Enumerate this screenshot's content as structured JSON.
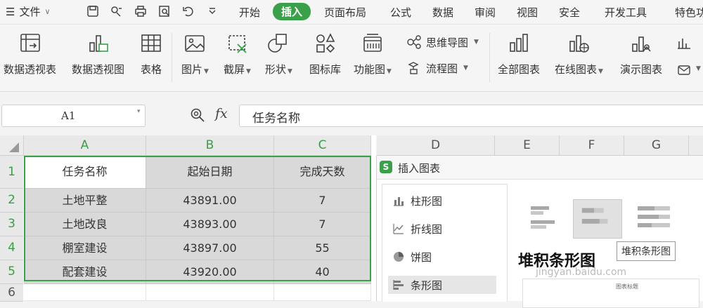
{
  "menubar": {
    "file_label": "文件",
    "tabs": [
      "开始",
      "插入",
      "页面布局",
      "公式",
      "数据",
      "审阅",
      "视图",
      "安全",
      "开发工具",
      "特色功"
    ],
    "active_tab": "插入"
  },
  "ribbon": {
    "pivot_table": "数据透视表",
    "pivot_chart": "数据透视图",
    "table": "表格",
    "picture": "图片",
    "screenshot": "截屏",
    "shapes": "形状",
    "icon_library": "图标库",
    "function_chart": "功能图",
    "mind_map": "思维导图",
    "flowchart": "流程图",
    "all_charts": "全部图表",
    "online_charts": "在线图表",
    "demo_chart": "演示图表"
  },
  "formula_bar": {
    "cell_ref": "A1",
    "fx_label": "fx",
    "value": "任务名称"
  },
  "sheet": {
    "columns": [
      "A",
      "B",
      "C"
    ],
    "right_columns": [
      "D",
      "E",
      "F",
      "G"
    ],
    "row_numbers": [
      "1",
      "2",
      "3",
      "4",
      "5",
      "6"
    ],
    "headers": [
      "任务名称",
      "起始日期",
      "完成天数"
    ],
    "rows": [
      [
        "土地平整",
        "43891.00",
        "7"
      ],
      [
        "土地改良",
        "43893.00",
        "7"
      ],
      [
        "棚室建设",
        "43897.00",
        "55"
      ],
      [
        "配套建设",
        "43920.00",
        "40"
      ]
    ]
  },
  "dialog": {
    "logo_letter": "S",
    "title": "插入图表",
    "chart_types": [
      "柱形图",
      "折线图",
      "饼图",
      "条形图"
    ],
    "selected_type": "条形图",
    "subtype_title": "堆积条形图",
    "tooltip": "堆积条形图",
    "preview_title": "图表标题"
  },
  "watermark": "jingyan.baidu.com",
  "colors": {
    "accent": "#3aa14a",
    "selected_fill": "#d9d9d9"
  }
}
